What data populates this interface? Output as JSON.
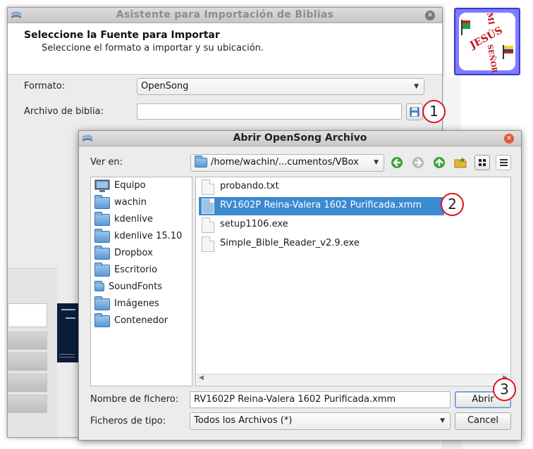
{
  "wizard": {
    "title": "Asistente para Importación de Biblias",
    "heading": "Seleccione la Fuente para Importar",
    "subheading": "Seleccione el formato a importar y su ubicación.",
    "format_label": "Formato:",
    "format_value": "OpenSong",
    "bible_file_label": "Archivo de biblia:",
    "bible_file_value": ""
  },
  "dialog": {
    "title": "Abrir OpenSong Archivo",
    "look_in_label": "Ver en:",
    "look_in_value": "/home/wachin/...cumentos/VBox",
    "places": [
      {
        "label": "Equipo",
        "icon": "computer-icon"
      },
      {
        "label": "wachin",
        "icon": "folder-icon"
      },
      {
        "label": "kdenlive",
        "icon": "folder-icon"
      },
      {
        "label": "kdenlive 15.10",
        "icon": "folder-icon"
      },
      {
        "label": "Dropbox",
        "icon": "folder-icon"
      },
      {
        "label": "Escritorio",
        "icon": "folder-icon"
      },
      {
        "label": "SoundFonts",
        "icon": "folder-link-icon"
      },
      {
        "label": "Imágenes",
        "icon": "folder-icon"
      },
      {
        "label": "Contenedor",
        "icon": "folder-icon"
      }
    ],
    "files": [
      {
        "label": "probando.txt",
        "selected": false
      },
      {
        "label": "RV1602P Reina-Valera 1602 Purificada.xmm",
        "selected": true
      },
      {
        "label": "setup1106.exe",
        "selected": false
      },
      {
        "label": "Simple_Bible_Reader_v2.9.exe",
        "selected": false
      }
    ],
    "filename_label": "Nombre de fichero:",
    "filename_value": "RV1602P Reina-Valera 1602 Purificada.xmm",
    "filetype_label": "Ficheros de tipo:",
    "filetype_value": "Todos los Archivos (*)",
    "open_button": "Abrir",
    "cancel_button": "Cancel"
  },
  "annotations": {
    "step1": "1",
    "step2": "2",
    "step3": "3"
  },
  "logo": {
    "text_top": "MI",
    "text_mid": "JESÚS",
    "text_bottom": "SEÑOR"
  },
  "colors": {
    "selection": "#3c8ad0",
    "badge_border": "#e0101a",
    "logo_bg": "#7e7cff"
  }
}
